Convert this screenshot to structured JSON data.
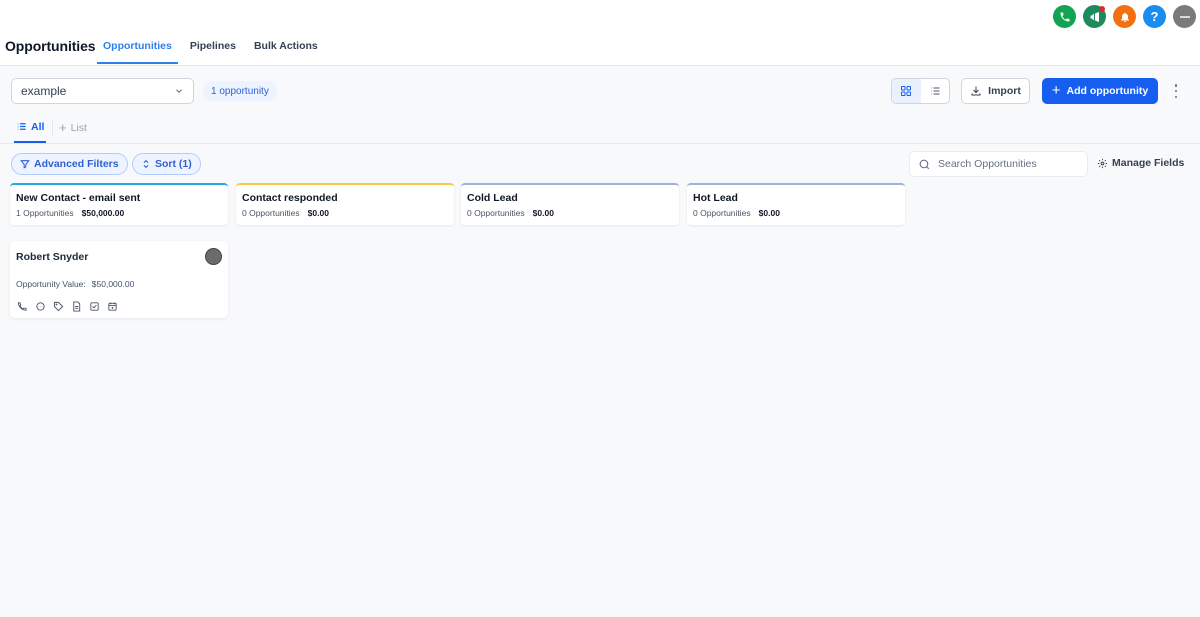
{
  "header": {
    "title": "Opportunities",
    "tabs": [
      {
        "label": "Opportunities",
        "active": true
      },
      {
        "label": "Pipelines",
        "active": false
      },
      {
        "label": "Bulk Actions",
        "active": false
      }
    ],
    "icons": [
      "phone-icon",
      "megaphone-icon",
      "bell-icon",
      "help-icon",
      "user-avatar"
    ],
    "help_label": "?"
  },
  "toolbar": {
    "pipeline": "example",
    "count_label": "1 opportunity",
    "import_label": "Import",
    "add_label": "Add opportunity"
  },
  "subtabs": {
    "all": "All",
    "list": "List"
  },
  "filters": {
    "advanced": "Advanced Filters",
    "sort": "Sort (1)",
    "search_placeholder": "Search Opportunities",
    "manage_fields": "Manage Fields"
  },
  "stages": [
    {
      "name": "New Contact - email sent",
      "count": "1 Opportunities",
      "amount": "$50,000.00",
      "color": "#22a9e8"
    },
    {
      "name": "Contact responded",
      "count": "0 Opportunities",
      "amount": "$0.00",
      "color": "#f7c948"
    },
    {
      "name": "Cold Lead",
      "count": "0 Opportunities",
      "amount": "$0.00",
      "color": "#9db4d8"
    },
    {
      "name": "Hot Lead",
      "count": "0 Opportunities",
      "amount": "$0.00",
      "color": "#9db4d8"
    }
  ],
  "card": {
    "name": "Robert Snyder",
    "value_label": "Opportunity Value:",
    "value": "$50,000.00",
    "actions": [
      "phone-icon",
      "chat-icon",
      "tag-icon",
      "note-icon",
      "task-icon",
      "calendar-icon"
    ]
  },
  "colors": {
    "primary": "#155eef",
    "tab_active": "#2f80ed"
  }
}
